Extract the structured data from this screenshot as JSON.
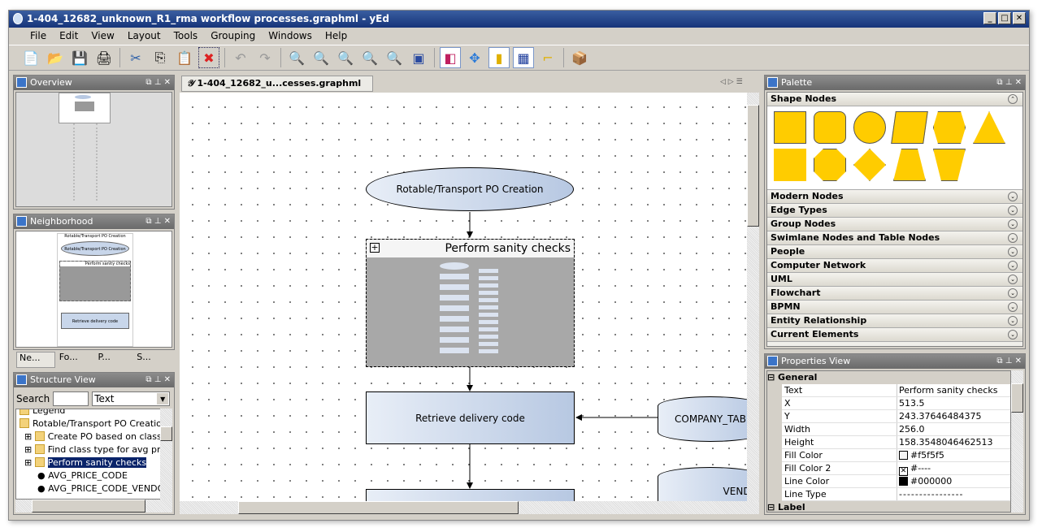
{
  "window": {
    "title": "1-404_12682_unknown_R1_rma workflow processes.graphml - yEd"
  },
  "menu": [
    "File",
    "Edit",
    "View",
    "Layout",
    "Tools",
    "Grouping",
    "Windows",
    "Help"
  ],
  "toolbar": [
    "new-document",
    "open",
    "save",
    "print",
    "cut",
    "copy",
    "paste",
    "delete",
    "undo",
    "redo",
    "zoom-in",
    "zoom-out",
    "zoom-1to1",
    "zoom-fit",
    "zoom-area",
    "fit-content",
    "select-mode",
    "navigate-mode",
    "snap-lines",
    "grid",
    "orthogonal-edges",
    "layout"
  ],
  "overview": {
    "title": "Overview"
  },
  "neighborhood": {
    "title": "Neighborhood",
    "top_node": "Rotable/Transport PO Creation",
    "ellipse": "Rotable/Transport PO Creation",
    "group": "Perform sanity checks",
    "bottom": "Retrieve delivery code"
  },
  "left_tabs": [
    "Ne...",
    "Fo...",
    "P...",
    "S..."
  ],
  "structure": {
    "title": "Structure View",
    "search_label": "Search",
    "search_value": "",
    "filter": "Text",
    "items": [
      {
        "label": "Legend",
        "type": "folder"
      },
      {
        "label": "Rotable/Transport PO Creation",
        "type": "folder"
      },
      {
        "label": "Create PO based on class ty",
        "type": "folder-expand"
      },
      {
        "label": "Find class type for avg price",
        "type": "folder-expand"
      },
      {
        "label": "Perform sanity checks",
        "type": "folder-expand",
        "selected": true
      },
      {
        "label": "AVG_PRICE_CODE",
        "type": "leaf"
      },
      {
        "label": "AVG_PRICE_CODE_VENDOF",
        "type": "leaf"
      }
    ]
  },
  "editor": {
    "tab": "1-404_12682_u...cesses.graphml",
    "nodes": {
      "start": "Rotable/Transport PO Creation",
      "group": "Perform sanity checks",
      "retrieve": "Retrieve delivery code",
      "company": "COMPANY_TAB",
      "vendor": "VENDO"
    }
  },
  "palette": {
    "title": "Palette",
    "open_section": "Shape Nodes",
    "sections": [
      "Modern Nodes",
      "Edge Types",
      "Group Nodes",
      "Swimlane Nodes and Table Nodes",
      "People",
      "Computer Network",
      "UML",
      "Flowchart",
      "BPMN",
      "Entity Relationship",
      "Current Elements"
    ],
    "shape_color": "#ffcc00"
  },
  "properties": {
    "title": "Properties View",
    "group": "General",
    "group2": "Label",
    "rows": [
      {
        "k": "Text",
        "v": "Perform sanity checks"
      },
      {
        "k": "X",
        "v": "513.5"
      },
      {
        "k": "Y",
        "v": "243.37646484375"
      },
      {
        "k": "Width",
        "v": "256.0"
      },
      {
        "k": "Height",
        "v": "158.3548046462513"
      },
      {
        "k": "Fill Color",
        "v": "#f5f5f5",
        "swatch": "#f5f5f5"
      },
      {
        "k": "Fill Color 2",
        "v": "#----",
        "swatch": "none"
      },
      {
        "k": "Line Color",
        "v": "#000000",
        "swatch": "#000000"
      },
      {
        "k": "Line Type",
        "v": "----------------"
      }
    ]
  }
}
